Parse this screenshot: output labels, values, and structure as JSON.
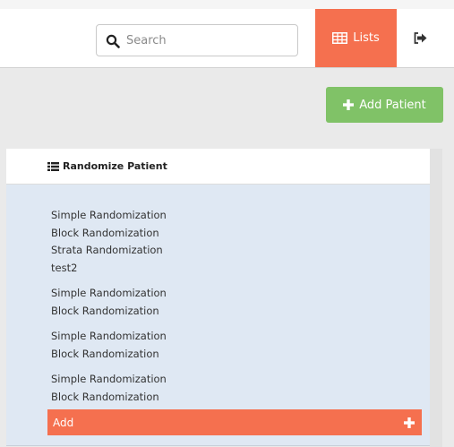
{
  "navbar": {
    "search_placeholder": "Search",
    "lists_label": "Lists",
    "icons": {
      "search": "search-icon",
      "lists": "table-icon",
      "logout": "sign-out-icon"
    }
  },
  "actions": {
    "add_patient_label": "Add Patient",
    "icon": "plus-icon"
  },
  "panel": {
    "title": "Randomize Patient",
    "title_icon": "list-icon",
    "groups": [
      {
        "items": [
          "Simple Randomization",
          "Block Randomization",
          "Strata Randomization",
          "test2"
        ]
      },
      {
        "items": [
          "Simple Randomization",
          "Block Randomization"
        ]
      },
      {
        "items": [
          "Simple Randomization",
          "Block Randomization"
        ]
      },
      {
        "items": [
          "Simple Randomization",
          "Block Randomization"
        ]
      }
    ],
    "add_label": "Add",
    "add_icon": "plus-icon"
  },
  "colors": {
    "accent": "#f5704f",
    "success": "#80c267",
    "panel_body": "#dfe8f3",
    "background": "#eaeaea"
  }
}
